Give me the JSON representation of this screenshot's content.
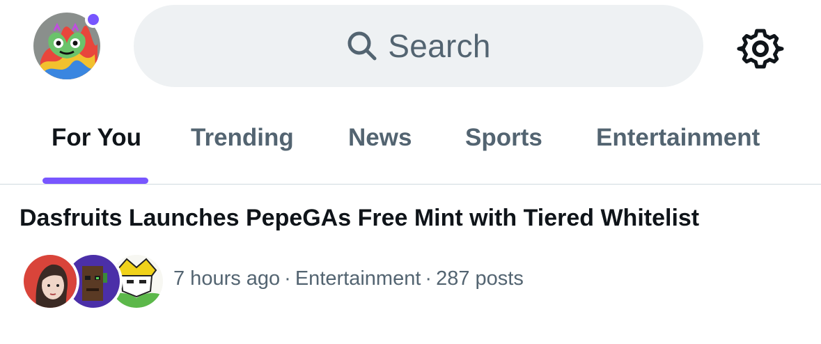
{
  "header": {
    "avatar_alt": "profile-avatar",
    "unread_color": "#7856ff",
    "search": {
      "placeholder": "Search",
      "icon": "search-icon"
    },
    "settings_icon": "gear-icon"
  },
  "tabs": [
    {
      "label": "For You",
      "active": true
    },
    {
      "label": "Trending",
      "active": false
    },
    {
      "label": "News",
      "active": false
    },
    {
      "label": "Sports",
      "active": false
    },
    {
      "label": "Entertainment",
      "active": false
    }
  ],
  "accent_color": "#7856ff",
  "trend": {
    "title": "Dasfruits Launches PepeGAs Free Mint with Tiered Whitelist",
    "time": "7 hours ago",
    "category": "Entertainment",
    "posts": "287 posts",
    "separator": "·"
  }
}
